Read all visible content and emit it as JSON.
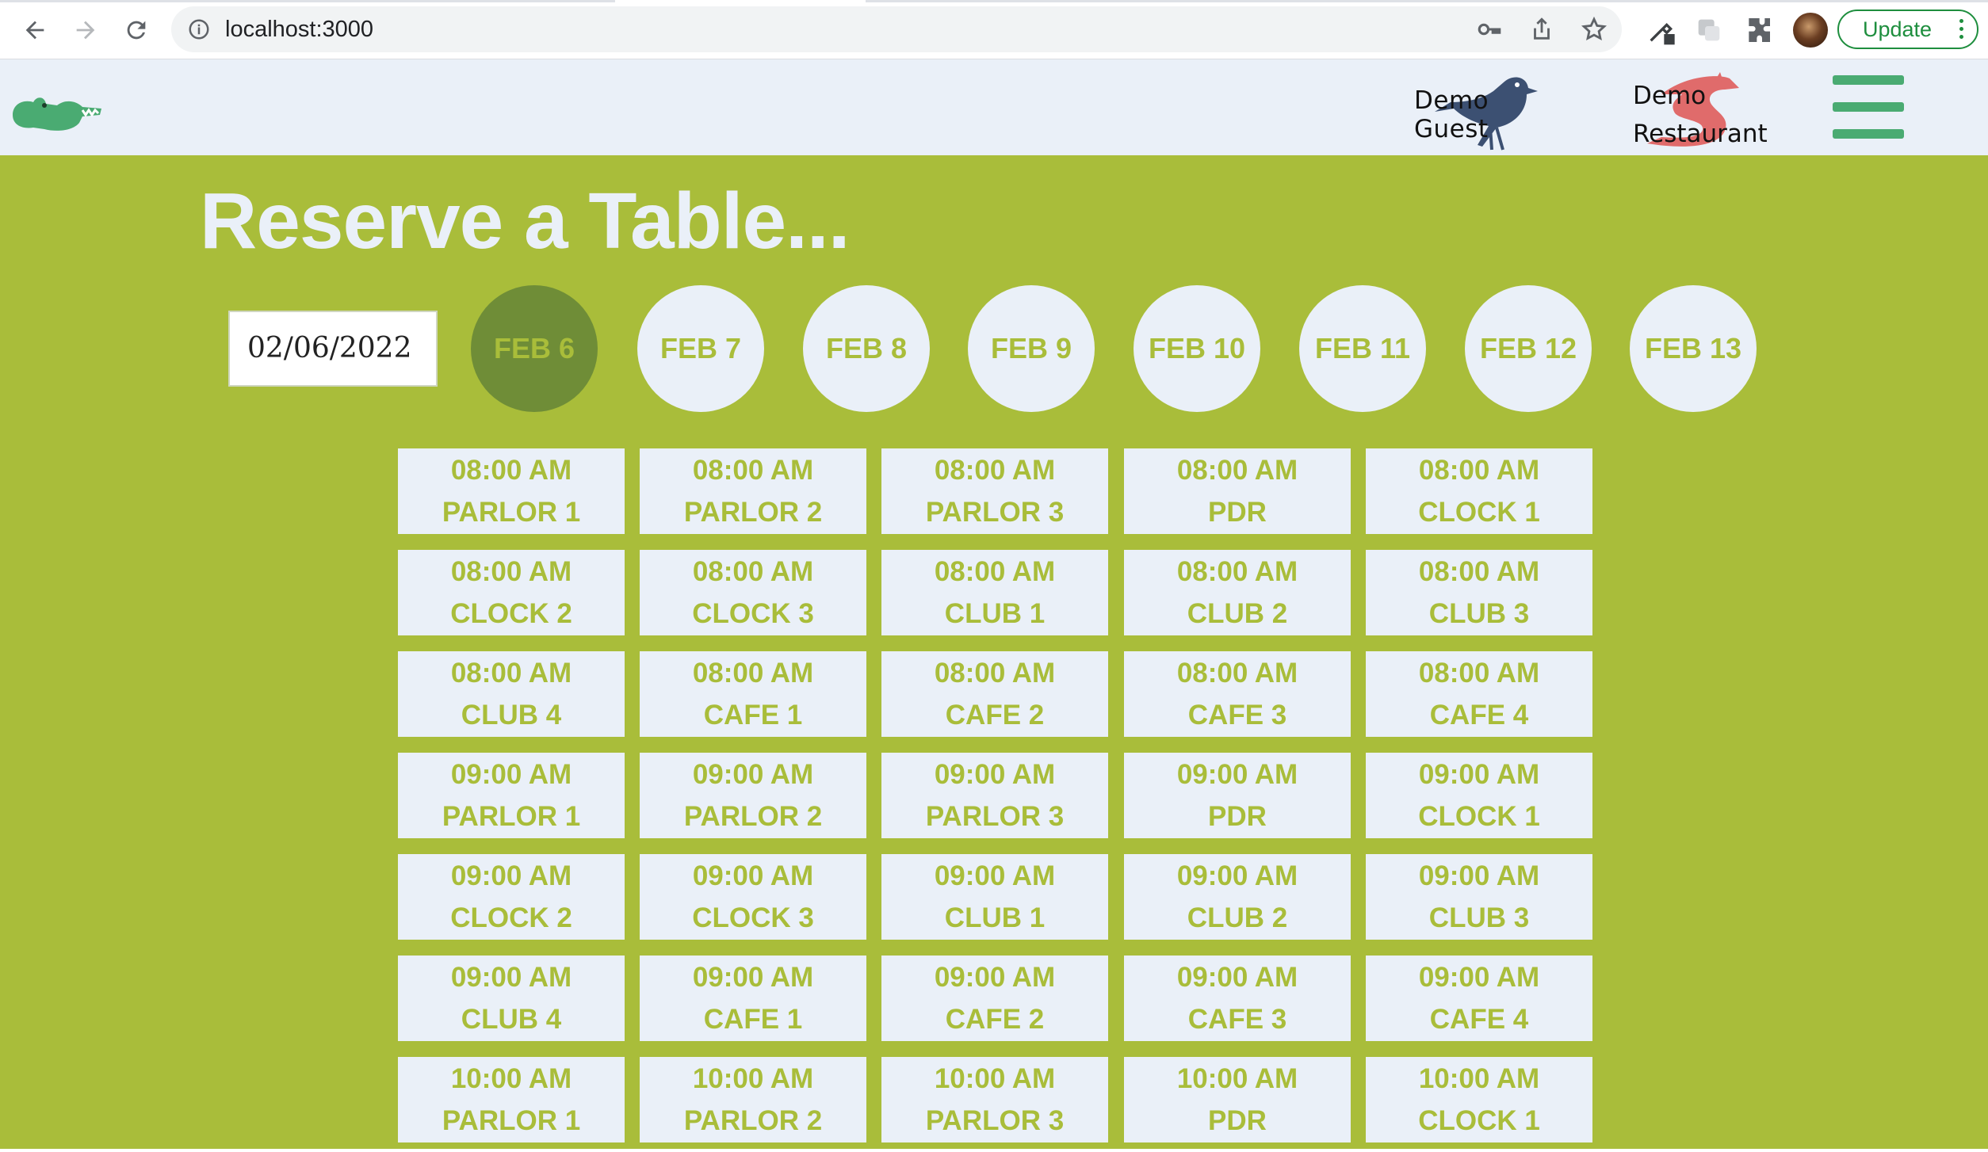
{
  "browser": {
    "url": "localhost:3000",
    "update_label": "Update"
  },
  "header": {
    "user_name": "Demo Guest",
    "restaurant_name_line1": "Demo",
    "restaurant_name_line2": "Restaurant",
    "accent_color": "#4aab72",
    "header_bg": "#eaf0f8"
  },
  "page": {
    "title": "Reserve a Table...",
    "background": "#a9bd3a",
    "date_value": "02/06/2022"
  },
  "days": [
    {
      "label": "FEB 6",
      "selected": true
    },
    {
      "label": "FEB 7",
      "selected": false
    },
    {
      "label": "FEB 8",
      "selected": false
    },
    {
      "label": "FEB 9",
      "selected": false
    },
    {
      "label": "FEB 10",
      "selected": false
    },
    {
      "label": "FEB 11",
      "selected": false
    },
    {
      "label": "FEB 12",
      "selected": false
    },
    {
      "label": "FEB 13",
      "selected": false
    }
  ],
  "slots": [
    {
      "time": "08:00 AM",
      "table": "PARLOR 1"
    },
    {
      "time": "08:00 AM",
      "table": "PARLOR 2"
    },
    {
      "time": "08:00 AM",
      "table": "PARLOR 3"
    },
    {
      "time": "08:00 AM",
      "table": "PDR"
    },
    {
      "time": "08:00 AM",
      "table": "CLOCK 1"
    },
    {
      "time": "08:00 AM",
      "table": "CLOCK 2"
    },
    {
      "time": "08:00 AM",
      "table": "CLOCK 3"
    },
    {
      "time": "08:00 AM",
      "table": "CLUB 1"
    },
    {
      "time": "08:00 AM",
      "table": "CLUB 2"
    },
    {
      "time": "08:00 AM",
      "table": "CLUB 3"
    },
    {
      "time": "08:00 AM",
      "table": "CLUB 4"
    },
    {
      "time": "08:00 AM",
      "table": "CAFE 1"
    },
    {
      "time": "08:00 AM",
      "table": "CAFE 2"
    },
    {
      "time": "08:00 AM",
      "table": "CAFE 3"
    },
    {
      "time": "08:00 AM",
      "table": "CAFE 4"
    },
    {
      "time": "09:00 AM",
      "table": "PARLOR 1"
    },
    {
      "time": "09:00 AM",
      "table": "PARLOR 2"
    },
    {
      "time": "09:00 AM",
      "table": "PARLOR 3"
    },
    {
      "time": "09:00 AM",
      "table": "PDR"
    },
    {
      "time": "09:00 AM",
      "table": "CLOCK 1"
    },
    {
      "time": "09:00 AM",
      "table": "CLOCK 2"
    },
    {
      "time": "09:00 AM",
      "table": "CLOCK 3"
    },
    {
      "time": "09:00 AM",
      "table": "CLUB 1"
    },
    {
      "time": "09:00 AM",
      "table": "CLUB 2"
    },
    {
      "time": "09:00 AM",
      "table": "CLUB 3"
    },
    {
      "time": "09:00 AM",
      "table": "CLUB 4"
    },
    {
      "time": "09:00 AM",
      "table": "CAFE 1"
    },
    {
      "time": "09:00 AM",
      "table": "CAFE 2"
    },
    {
      "time": "09:00 AM",
      "table": "CAFE 3"
    },
    {
      "time": "09:00 AM",
      "table": "CAFE 4"
    },
    {
      "time": "10:00 AM",
      "table": "PARLOR 1"
    },
    {
      "time": "10:00 AM",
      "table": "PARLOR 2"
    },
    {
      "time": "10:00 AM",
      "table": "PARLOR 3"
    },
    {
      "time": "10:00 AM",
      "table": "PDR"
    },
    {
      "time": "10:00 AM",
      "table": "CLOCK 1"
    }
  ]
}
